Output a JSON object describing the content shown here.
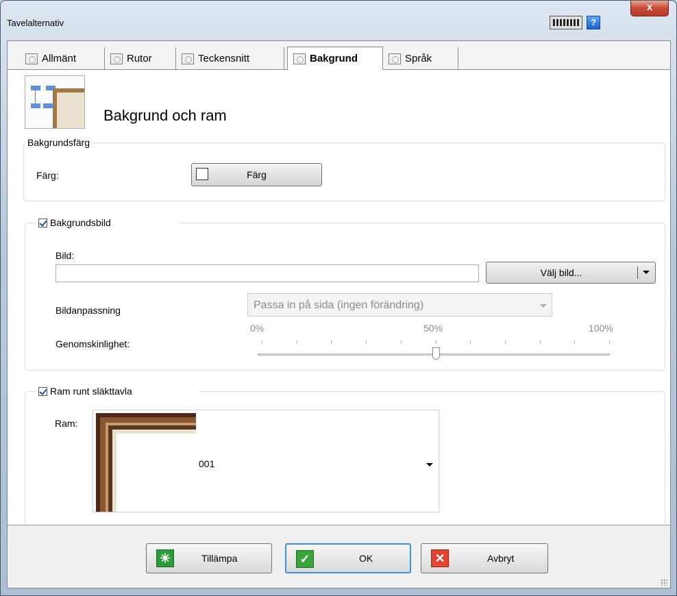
{
  "window": {
    "title": "Tavelalternativ",
    "help_label": "?",
    "close_label": "x"
  },
  "tabs": [
    {
      "label": "Allmänt",
      "active": false
    },
    {
      "label": "Rutor",
      "active": false
    },
    {
      "label": "Teckensnitt",
      "active": false
    },
    {
      "label": "Bakgrund",
      "active": true
    },
    {
      "label": "Språk",
      "active": false
    }
  ],
  "header": {
    "title": "Bakgrund och ram"
  },
  "background_color": {
    "group_label": "Bakgrundsfärg",
    "color_label": "Färg:",
    "color_button": "Färg",
    "swatch_color": "#ffffff"
  },
  "background_image": {
    "checkbox_label": "Bakgrundsbild",
    "checked": true,
    "image_label": "Bild:",
    "image_path": "",
    "choose_button": "Välj bild...",
    "fit_label": "Bildanpassning",
    "fit_value": "Passa in på sida (ingen förändring)",
    "transparency_label": "Genomskinlighet:",
    "tick_labels": [
      "0%",
      "50%",
      "100%"
    ],
    "transparency_percent": 50
  },
  "frame": {
    "checkbox_label": "Ram runt släkttavla",
    "checked": true,
    "frame_label": "Ram:",
    "frame_value": "001"
  },
  "footer": {
    "apply": "Tillämpa",
    "ok": "OK",
    "cancel": "Avbryt"
  },
  "colors": {
    "ok_border": "#3c8fd9",
    "apply_icon": "#2e9b3a",
    "cancel_icon": "#e2452f",
    "close_button": "#c74a34"
  }
}
